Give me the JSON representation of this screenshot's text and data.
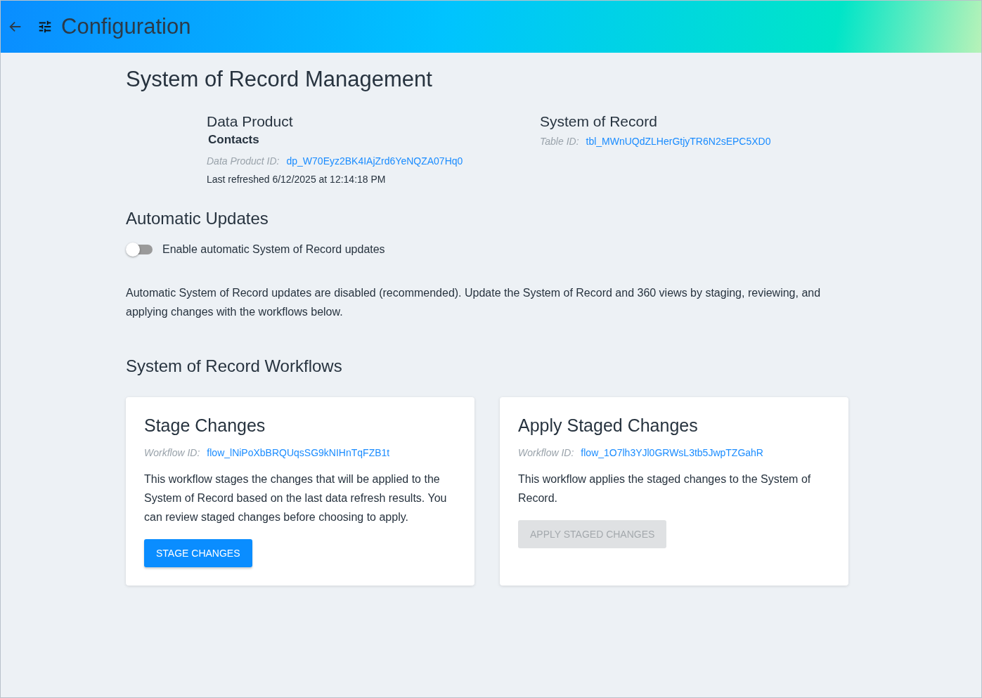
{
  "header": {
    "title": "Configuration"
  },
  "page_title": "System of Record Management",
  "data_product": {
    "heading": "Data Product",
    "name": "Contacts",
    "id_label": "Data Product ID:",
    "id": "dp_W70Eyz2BK4IAjZrd6YeNQZA07Hq0",
    "refreshed": "Last refreshed 6/12/2025 at 12:14:18 PM"
  },
  "system_of_record": {
    "heading": "System of Record",
    "id_label": "Table ID:",
    "id": "tbl_MWnUQdZLHerGtjyTR6N2sEPC5XD0"
  },
  "automatic_updates": {
    "heading": "Automatic Updates",
    "toggle_label": "Enable automatic System of Record updates",
    "on": false,
    "note": "Automatic System of Record updates are disabled (recommended). Update the System of Record and 360 views by staging, reviewing, and applying changes with the workflows below."
  },
  "workflows_heading": "System of Record Workflows",
  "workflows": [
    {
      "title": "Stage Changes",
      "id_label": "Workflow ID:",
      "id": "flow_lNiPoXbBRQUqsSG9kNIHnTqFZB1t",
      "description": "This workflow stages the changes that will be applied to the System of Record based on the last data refresh results. You can review staged changes before choosing to apply.",
      "button": "STAGE CHANGES",
      "disabled": false
    },
    {
      "title": "Apply Staged Changes",
      "id_label": "Workflow ID:",
      "id": "flow_1O7lh3YJl0GRWsL3tb5JwpTZGahR",
      "description": "This workflow applies the staged changes to the System of Record.",
      "button": "APPLY STAGED CHANGES",
      "disabled": true
    }
  ]
}
